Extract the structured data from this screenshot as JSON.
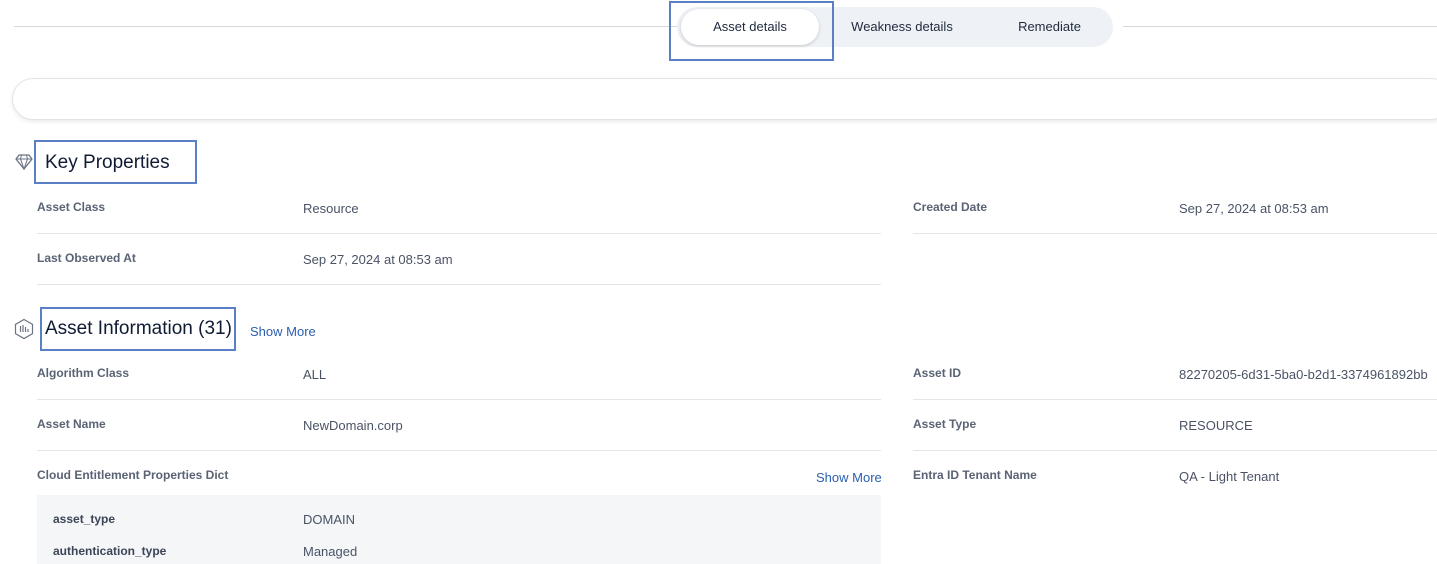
{
  "tabs": {
    "asset_details": "Asset details",
    "weakness_details": "Weakness details",
    "remediate": "Remediate"
  },
  "key_properties": {
    "title": "Key Properties",
    "icon": "diamond-icon",
    "fields": {
      "asset_class": {
        "label": "Asset Class",
        "value": "Resource"
      },
      "created_date": {
        "label": "Created Date",
        "value": "Sep 27, 2024 at 08:53 am"
      },
      "last_observed": {
        "label": "Last Observed At",
        "value": "Sep 27, 2024 at 08:53 am"
      }
    }
  },
  "asset_information": {
    "title": "Asset Information (31)",
    "icon": "asset-info-icon",
    "show_more": "Show More",
    "fields": {
      "algorithm_class": {
        "label": "Algorithm Class",
        "value": "ALL"
      },
      "asset_id": {
        "label": "Asset ID",
        "value": "82270205-6d31-5ba0-b2d1-3374961892bb"
      },
      "asset_name": {
        "label": "Asset Name",
        "value": "NewDomain.corp"
      },
      "asset_type": {
        "label": "Asset Type",
        "value": "RESOURCE"
      },
      "cloud_entitlement": {
        "label": "Cloud Entitlement Properties Dict",
        "show_more": "Show More"
      },
      "entra_tenant": {
        "label": "Entra ID Tenant Name",
        "value": "QA - Light Tenant"
      }
    },
    "dict_items": [
      {
        "key": "asset_type",
        "value": "DOMAIN"
      },
      {
        "key": "authentication_type",
        "value": "Managed"
      }
    ]
  },
  "colors": {
    "accent_link": "#2a5fb0",
    "highlight_border": "#5b7fc4",
    "tab_bg": "#eef1f5"
  }
}
